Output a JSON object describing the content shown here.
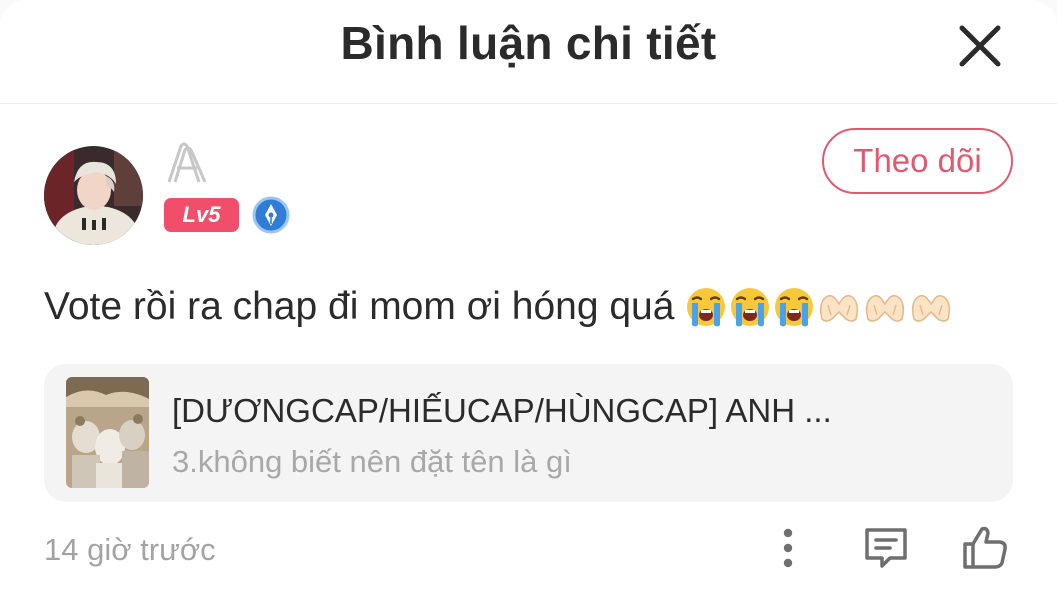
{
  "header": {
    "title": "Bình luận chi tiết"
  },
  "author": {
    "level_badge": "Lv5",
    "follow_label": "Theo dõi"
  },
  "comment": {
    "text": "Vote rồi ra chap đi mom ơi hóng quá",
    "emojis": [
      "loudly-crying-face",
      "loudly-crying-face",
      "loudly-crying-face",
      "heart-hands",
      "heart-hands",
      "heart-hands"
    ]
  },
  "story": {
    "title": "[DƯƠNGCAP/HIẾUCAP/HÙNGCAP] ANH ...",
    "chapter": "3.không biết nên đặt tên là gì"
  },
  "footer": {
    "timestamp": "14 giờ trước",
    "icons": [
      "more-vertical-icon",
      "reply-icon",
      "like-icon"
    ]
  },
  "colors": {
    "accent": "#e2596f",
    "level_badge_bg": "#f04e6b",
    "card_bg": "#f4f4f5",
    "muted_text": "#a3a3a3"
  }
}
